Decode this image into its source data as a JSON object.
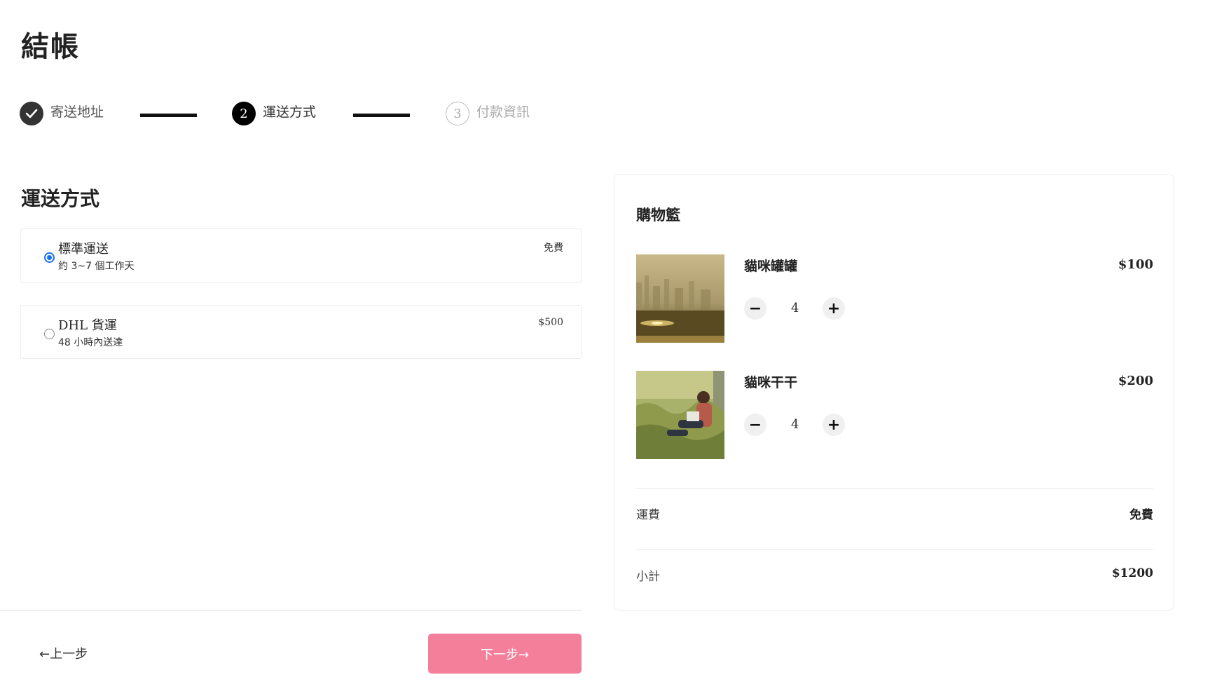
{
  "page": {
    "title": "結帳"
  },
  "stepper": {
    "steps": [
      {
        "number": "",
        "label": "寄送地址",
        "state": "done"
      },
      {
        "number": "2",
        "label": "運送方式",
        "state": "active"
      },
      {
        "number": "3",
        "label": "付款資訊",
        "state": "pending"
      }
    ]
  },
  "shipping": {
    "title": "運送方式",
    "options": [
      {
        "name": "標準運送",
        "desc": "約 3~7 個工作天",
        "price": "免費",
        "selected": true
      },
      {
        "name": "DHL 貨運",
        "desc": "48 小時內送達",
        "price": "$500",
        "selected": false
      }
    ]
  },
  "nav": {
    "back_label": "←上一步",
    "next_label": "下一步→",
    "next_color": "#f37f9b"
  },
  "cart": {
    "title": "購物籃",
    "items": [
      {
        "name": "貓咪罐罐",
        "price": "$100",
        "quantity": "4"
      },
      {
        "name": "貓咪干干",
        "price": "$200",
        "quantity": "4"
      }
    ],
    "qty_minus": "−",
    "qty_plus": "+",
    "shipping_label": "運費",
    "shipping_value": "免費",
    "subtotal_label": "小計",
    "subtotal_value": "$1200"
  }
}
